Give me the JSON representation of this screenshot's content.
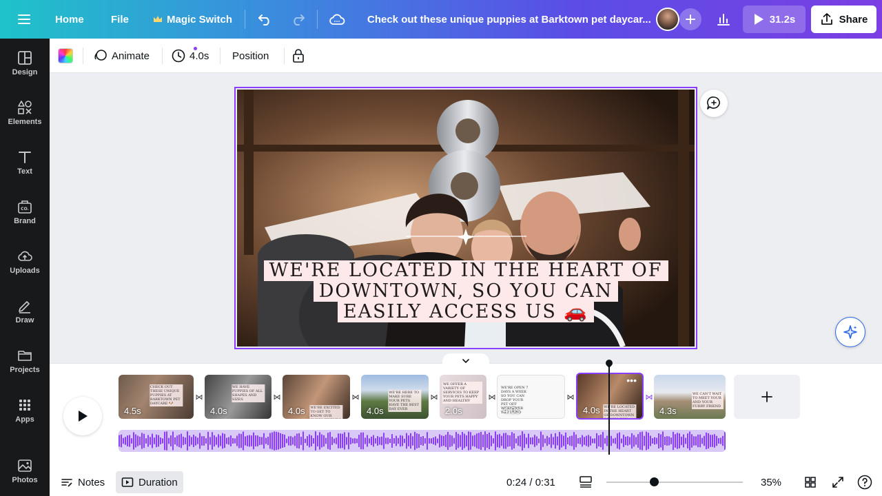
{
  "topbar": {
    "home": "Home",
    "file": "File",
    "magic_switch": "Magic Switch",
    "doc_title": "Check out these unique puppies at Barktown pet daycar...",
    "play_duration": "31.2s",
    "share": "Share"
  },
  "sidebar": {
    "items": [
      {
        "label": "Design",
        "icon": "layout-icon"
      },
      {
        "label": "Elements",
        "icon": "shapes-icon"
      },
      {
        "label": "Text",
        "icon": "text-icon"
      },
      {
        "label": "Brand",
        "icon": "brand-icon"
      },
      {
        "label": "Uploads",
        "icon": "cloud-upload-icon"
      },
      {
        "label": "Draw",
        "icon": "pen-icon"
      },
      {
        "label": "Projects",
        "icon": "folder-icon"
      },
      {
        "label": "Apps",
        "icon": "grid-icon"
      },
      {
        "label": "Photos",
        "icon": "image-icon"
      }
    ]
  },
  "toolbar": {
    "animate": "Animate",
    "duration": "4.0s",
    "position": "Position"
  },
  "canvas": {
    "caption_lines": [
      "WE'RE LOCATED IN THE HEART OF",
      "DOWNTOWN, SO YOU CAN",
      "EASILY ACCESS US 🚗"
    ]
  },
  "timeline": {
    "clips": [
      {
        "duration": "4.5s",
        "text": "CHECK OUT THESE UNIQUE PUPPIES AT BARKTOWN PET DAYCARE 🐶"
      },
      {
        "duration": "4.0s",
        "text": "WE HAVE PUPPIES OF ALL SHAPES AND SIZES"
      },
      {
        "duration": "4.0s",
        "text": "WE'RE EXCITED TO GET TO KNOW OUR FURRY FRIENDS 🐾"
      },
      {
        "duration": "4.0s",
        "text": "WE'RE HERE TO MAKE SURE YOUR PETS HAVE THE BEST DAY EVER"
      },
      {
        "duration": "2.0s",
        "text": "WE OFFER A VARIETY OF SERVICES TO KEEP YOUR PETS HAPPY AND HEALTHY"
      },
      {
        "duration": "4.0s",
        "text": "WE'RE OPEN 7 DAYS A WEEK SO YOU CAN DROP YOUR PET OFF WHENEVER YOU NEED"
      },
      {
        "duration": "4.0s",
        "text": "WE'RE LOCATED IN THE HEART OF DOWNTOWN SO YOU CAN EASILY ACCESS US"
      },
      {
        "duration": "4.3s",
        "text": "WE CAN'T WAIT TO MEET YOUR AND YOUR FURRY FRIEND"
      }
    ],
    "add_label": "+"
  },
  "bottombar": {
    "notes": "Notes",
    "duration": "Duration",
    "time": "0:24 / 0:31",
    "zoom": "35%",
    "zoom_level": 0.35
  },
  "colors": {
    "accent": "#8b3dff",
    "sidebar_bg": "#18191b"
  }
}
